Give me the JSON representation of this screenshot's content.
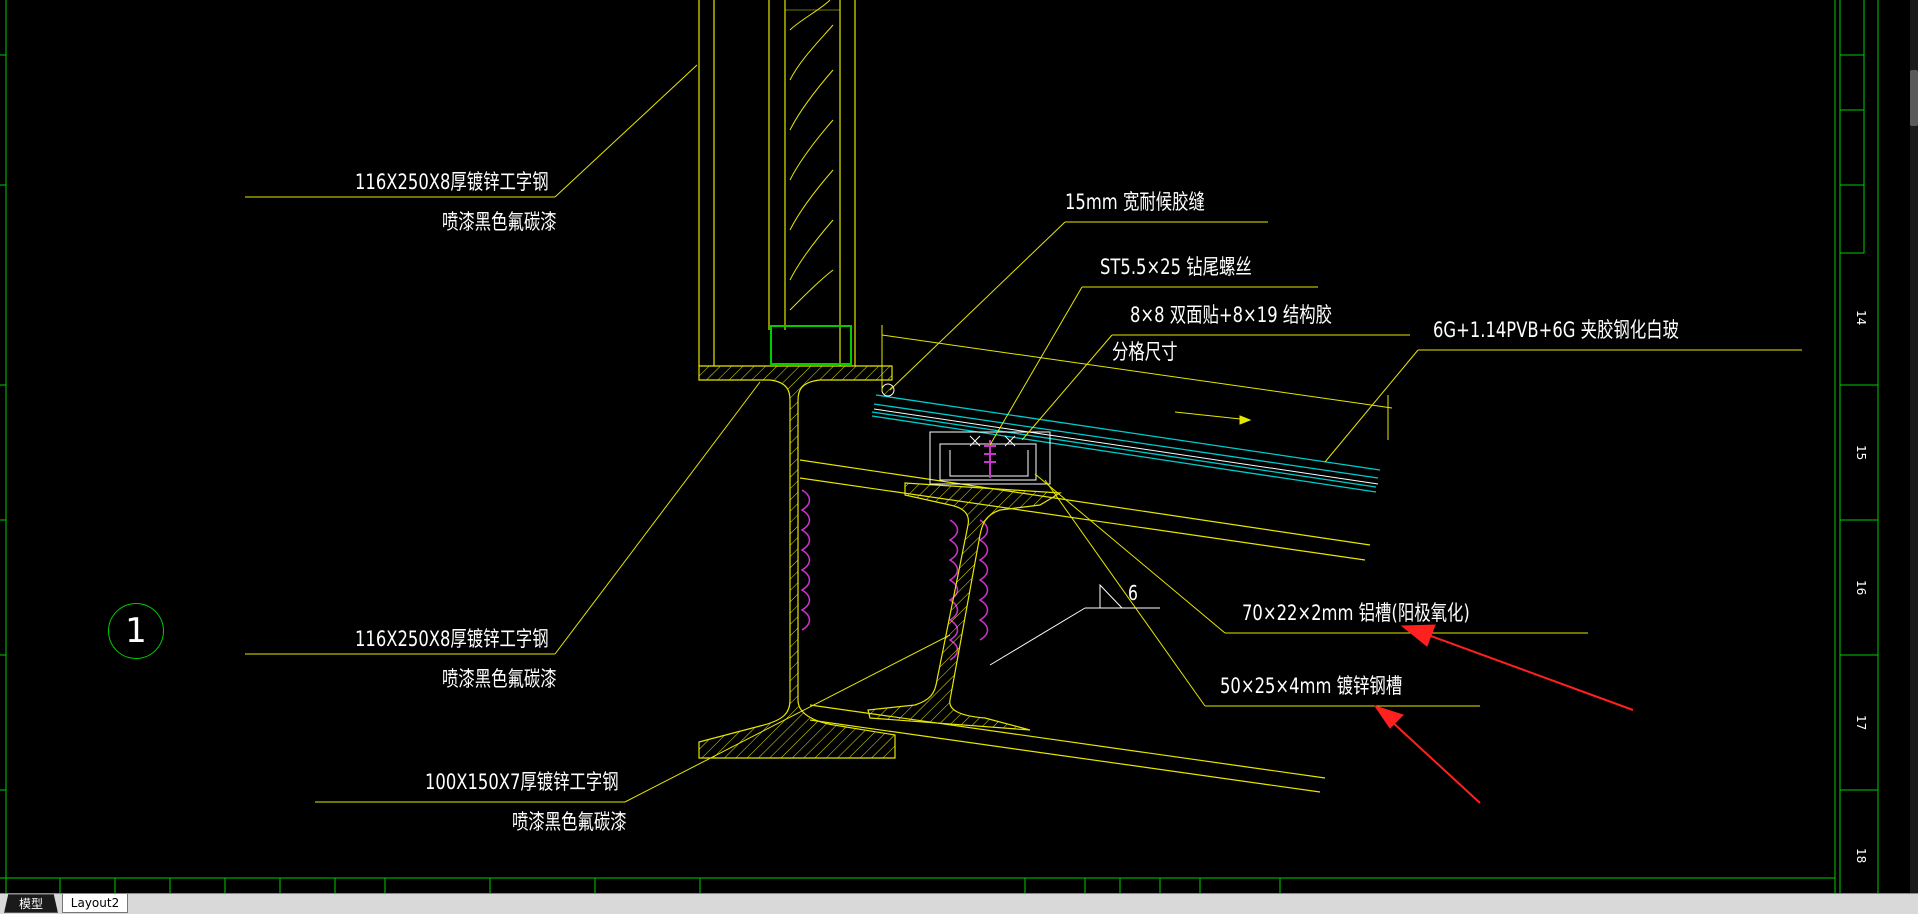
{
  "labels": {
    "beam_top_1": "116X250X8厚镀锌工字钢",
    "beam_top_2": "喷漆黑色氟碳漆",
    "seam": "15mm 宽耐候胶缝",
    "screw": "ST5.5×25 钻尾螺丝",
    "tape": "8×8 双面贴+8×19 结构胶",
    "grid": "分格尺寸",
    "glass": "6G+1.14PVB+6G 夹胶钢化白玻",
    "beam_mid_1": "116X250X8厚镀锌工字钢",
    "beam_mid_2": "喷漆黑色氟碳漆",
    "weld": "6",
    "alu_channel": "70×22×2mm 铝槽(阳极氧化)",
    "steel_channel": "50×25×4mm 镀锌钢槽",
    "beam_low_1": "100X150X7厚镀锌工字钢",
    "beam_low_2": "喷漆黑色氟碳漆"
  },
  "detail_marker": "1",
  "right_ruler": [
    "14",
    "15",
    "16",
    "17",
    "18"
  ],
  "tabs": {
    "model": "模型",
    "layout2": "Layout2"
  },
  "colors": {
    "background": "#000000",
    "leader": "#e6e600",
    "glass": "#00cccc",
    "weld": "#cc33cc",
    "frame": "#00cc00",
    "arrow": "#ff2020"
  }
}
